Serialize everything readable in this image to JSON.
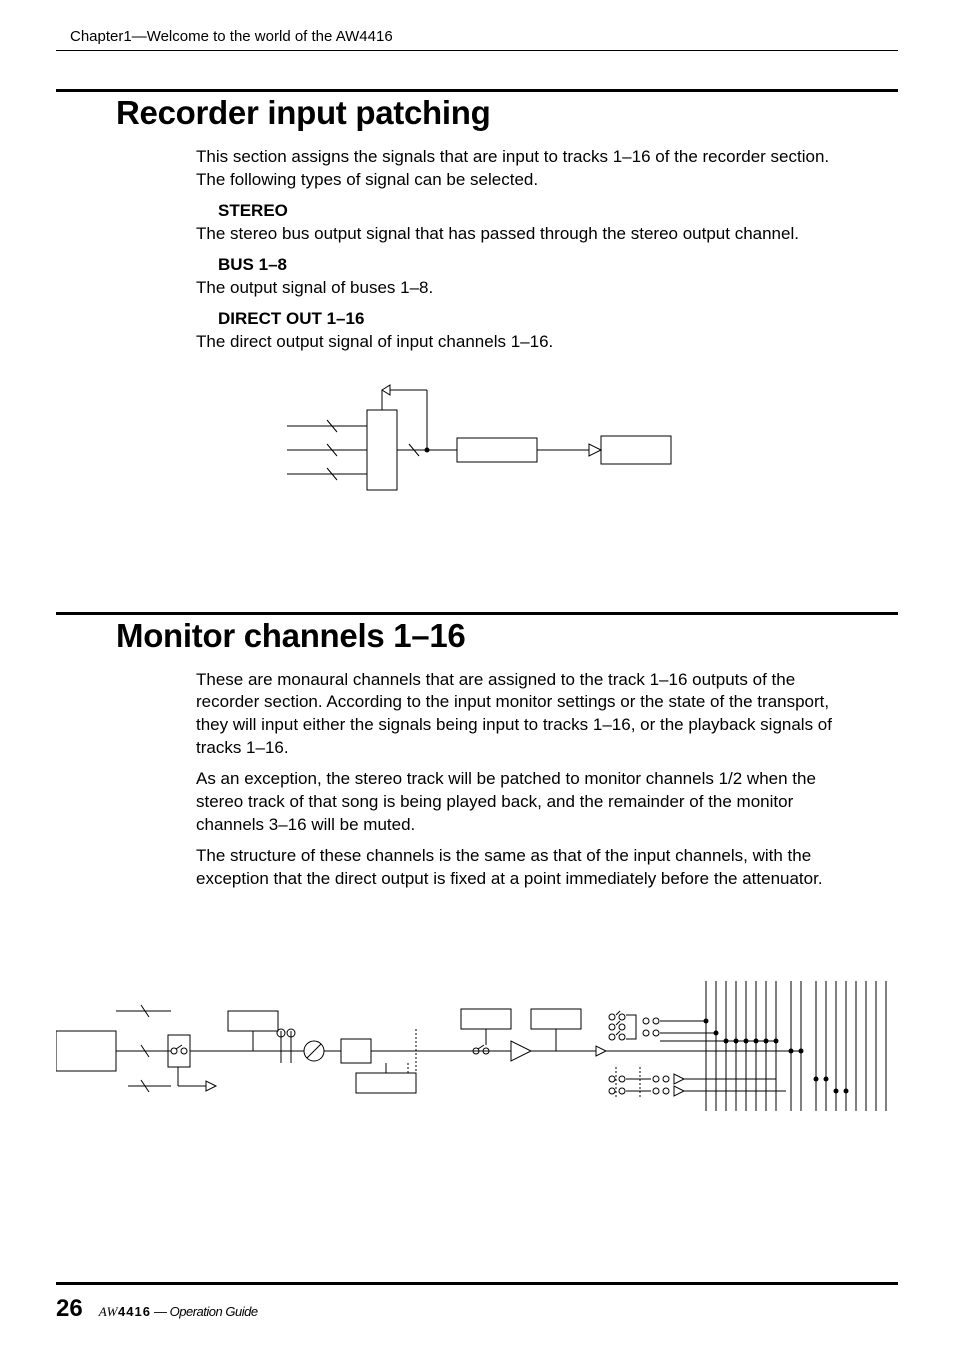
{
  "header": {
    "chapter": "Chapter1—Welcome to the world of the AW4416"
  },
  "section1": {
    "title": "Recorder input patching",
    "intro": "This section assigns the signals that are input to tracks 1–16 of the recorder section. The following types of signal can be selected.",
    "items": [
      {
        "head": "STEREO",
        "text": "The stereo bus output signal that has passed through the stereo output channel."
      },
      {
        "head": "BUS 1–8",
        "text": "The output signal of buses 1–8."
      },
      {
        "head": "DIRECT OUT 1–16",
        "text": "The direct output signal of input channels 1–16."
      }
    ]
  },
  "section2": {
    "title": "Monitor channels 1–16",
    "paras": [
      "These are monaural channels that are assigned to the track 1–16 outputs of the recorder section. According to the input monitor settings or the state of the transport, they will input either the signals being input to tracks 1–16, or the playback signals of tracks 1–16.",
      "As an exception, the stereo track will be patched to monitor channels 1/2 when the stereo track of that song is being played back, and the remainder of the monitor channels 3–16 will be muted.",
      "The structure of these channels is the same as that of the input channels, with the exception that the direct output is fixed at a point immediately before the attenuator."
    ]
  },
  "footer": {
    "page": "26",
    "product_prefix": "AW",
    "product_model": "4416",
    "guide": " — Operation Guide"
  }
}
